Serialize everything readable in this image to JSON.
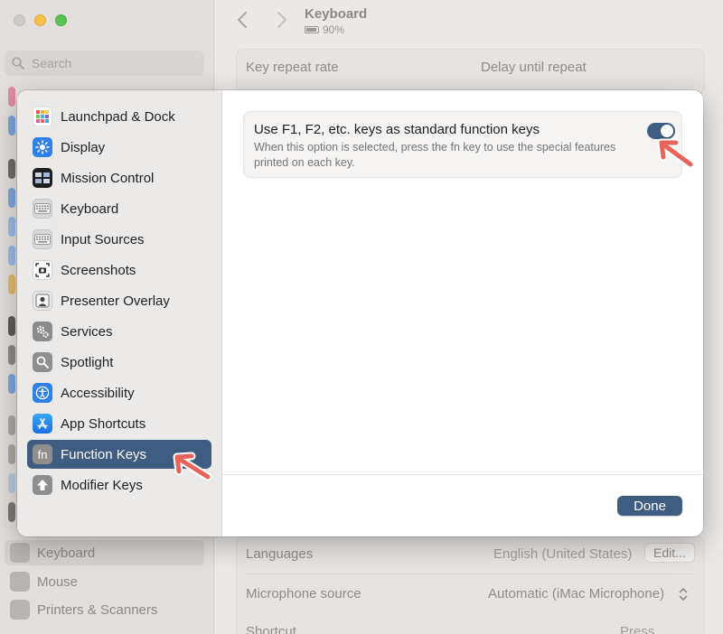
{
  "background": {
    "search_placeholder": "Search",
    "header_title": "Keyboard",
    "battery_percent": "90%",
    "key_repeat_label": "Key repeat rate",
    "delay_label": "Delay until repeat",
    "sidebar_items": [
      {
        "label": "Keyboard"
      },
      {
        "label": "Mouse"
      },
      {
        "label": "Printers & Scanners"
      }
    ],
    "languages_label": "Languages",
    "languages_value": "English (United States)",
    "edit_button": "Edit...",
    "microphone_label": "Microphone source",
    "microphone_value": "Automatic (iMac Microphone)",
    "shortcut_label": "Shortcut",
    "shortcut_value": "Press"
  },
  "dialog": {
    "sidebar": [
      {
        "label": "Launchpad & Dock",
        "icon": "launchpad-icon"
      },
      {
        "label": "Display",
        "icon": "display-icon"
      },
      {
        "label": "Mission Control",
        "icon": "mission-control-icon"
      },
      {
        "label": "Keyboard",
        "icon": "keyboard-icon"
      },
      {
        "label": "Input Sources",
        "icon": "input-sources-icon"
      },
      {
        "label": "Screenshots",
        "icon": "screenshots-icon"
      },
      {
        "label": "Presenter Overlay",
        "icon": "presenter-overlay-icon"
      },
      {
        "label": "Services",
        "icon": "services-icon"
      },
      {
        "label": "Spotlight",
        "icon": "spotlight-icon"
      },
      {
        "label": "Accessibility",
        "icon": "accessibility-icon"
      },
      {
        "label": "App Shortcuts",
        "icon": "app-shortcuts-icon"
      },
      {
        "label": "Function Keys",
        "icon": "fn-icon",
        "icon_text": "fn",
        "selected": true
      },
      {
        "label": "Modifier Keys",
        "icon": "modifier-keys-icon"
      }
    ],
    "option": {
      "title": "Use F1, F2, etc. keys as standard function keys",
      "description": "When this option is selected, press the fn key to use the special features printed on each key.",
      "enabled": true
    },
    "done_button": "Done"
  },
  "colors": {
    "accent": "#3f5d80",
    "annotation_arrow": "#e8645a"
  }
}
